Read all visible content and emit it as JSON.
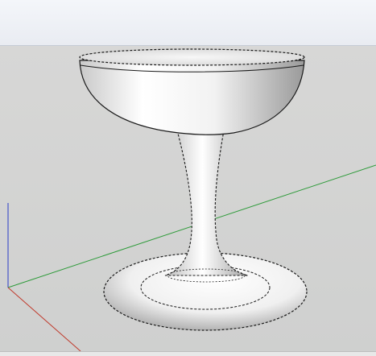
{
  "app": {
    "window_title": ""
  },
  "viewport": {
    "model": "goblet",
    "background_color": "#d2d3d2",
    "axes": {
      "red": "#c0392b",
      "green": "#2e9b3a",
      "blue": "#2a3cc8"
    }
  },
  "status": {
    "text": ""
  }
}
